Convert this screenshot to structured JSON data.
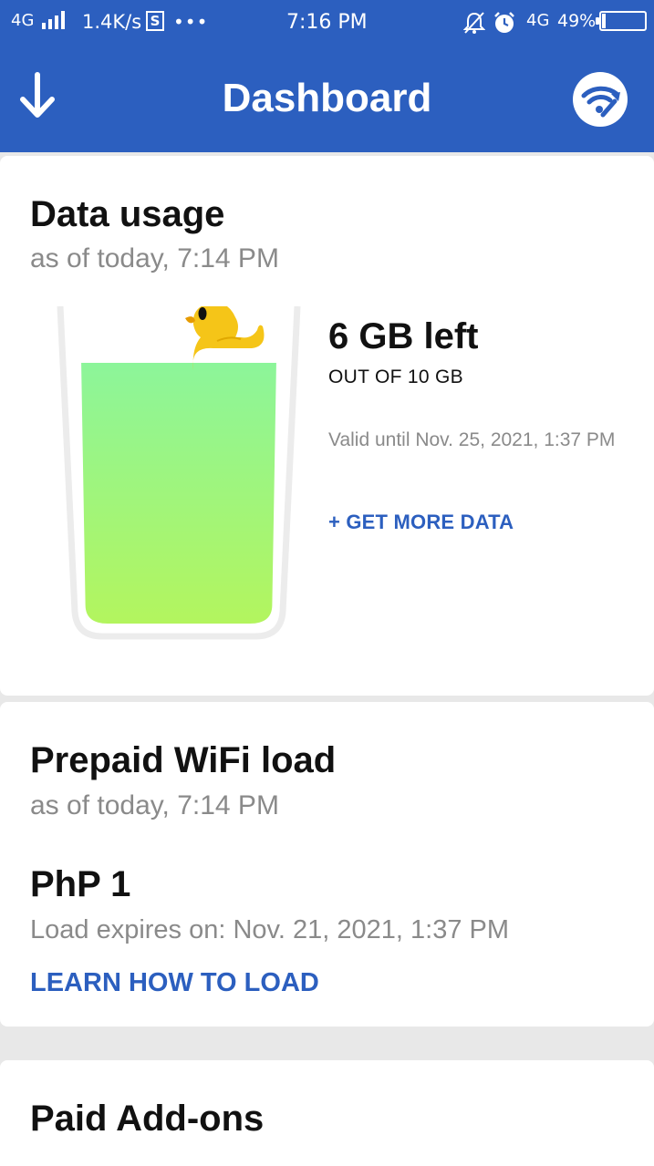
{
  "status_bar": {
    "network_left": "4G",
    "speed": "1.4K/s",
    "s_icon": "S",
    "more": "•••",
    "time": "7:16 PM",
    "network_right": "4G",
    "battery_pct": "49%",
    "icons": [
      "signal-icon",
      "bell-off-icon",
      "alarm-icon",
      "battery-icon"
    ]
  },
  "app_bar": {
    "title": "Dashboard",
    "left_icon": "download-arrow-icon",
    "right_icon": "wifi-wrench-icon"
  },
  "data_usage": {
    "title": "Data usage",
    "subtitle": "as of today, 7:14 PM",
    "remaining": "6 GB left",
    "total": "OUT OF 10 GB",
    "valid_until": "Valid until Nov. 25, 2021, 1:37 PM",
    "action": "+ GET MORE DATA",
    "remaining_fraction": 0.6
  },
  "prepaid_wifi": {
    "title": "Prepaid WiFi load",
    "subtitle": "as of today, 7:14 PM",
    "amount": "PhP 1",
    "expiry": "Load expires on: Nov. 21, 2021, 1:37 PM",
    "action": "LEARN HOW TO LOAD"
  },
  "paid_addons": {
    "title": "Paid Add-ons"
  },
  "colors": {
    "brand_blue": "#2c5fbf",
    "liquid_top": "#8cf59a",
    "liquid_bottom": "#b3f55e",
    "duck": "#f5c518"
  }
}
